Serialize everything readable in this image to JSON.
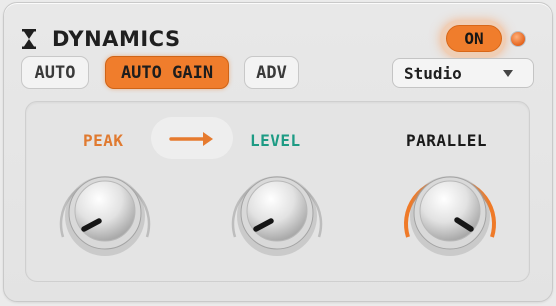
{
  "header": {
    "title": "DYNAMICS",
    "power_label": "ON"
  },
  "modes": [
    {
      "label": "AUTO",
      "active": false
    },
    {
      "label": "AUTO GAIN",
      "active": true
    },
    {
      "label": "ADV",
      "active": false
    }
  ],
  "preset": {
    "value": "Studio"
  },
  "knobs": [
    {
      "label": "PEAK",
      "label_color": "#e07a30"
    },
    {
      "label": "LEVEL",
      "label_color": "#1d9b84"
    },
    {
      "label": "PARALLEL",
      "label_color": "#1a1a1a"
    }
  ],
  "colors": {
    "accent": "#f07d2c",
    "teal": "#1d9b84"
  },
  "icons": {
    "title": "hourglass-icon",
    "link": "arrow-right-icon",
    "dropdown": "chevron-down-icon"
  }
}
